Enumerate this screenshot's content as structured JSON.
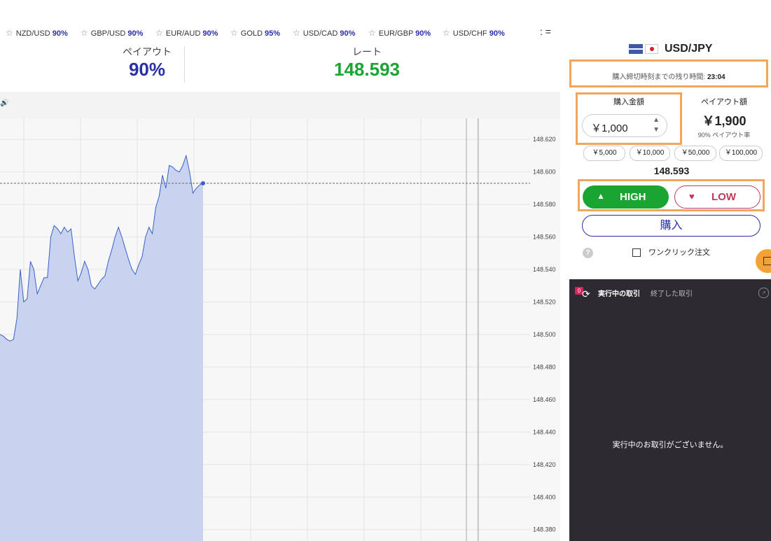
{
  "ticker": {
    "items": [
      {
        "symbol": "NZD/USD",
        "payout": "90%"
      },
      {
        "symbol": "GBP/USD",
        "payout": "90%"
      },
      {
        "symbol": "EUR/AUD",
        "payout": "90%"
      },
      {
        "symbol": "GOLD",
        "payout": "95%"
      },
      {
        "symbol": "USD/CAD",
        "payout": "90%"
      },
      {
        "symbol": "EUR/GBP",
        "payout": "90%"
      },
      {
        "symbol": "USD/CHF",
        "payout": "90%"
      }
    ],
    "menu_glyph": ": ="
  },
  "header": {
    "payout_label": "ペイアウト",
    "payout_value": "90%",
    "rate_label": "レート",
    "rate_value": "148.593"
  },
  "chart": {
    "sound_glyph": "🔊",
    "y_ticks": [
      "148.620",
      "148.600",
      "148.580",
      "148.560",
      "148.540",
      "148.520",
      "148.500",
      "148.480",
      "148.460",
      "148.440",
      "148.420",
      "148.400",
      "148.380"
    ]
  },
  "chart_data": {
    "type": "area",
    "ylim": [
      148.373,
      148.633
    ],
    "y": [
      148.5,
      148.499,
      148.497,
      148.496,
      148.497,
      148.51,
      148.54,
      148.52,
      148.522,
      148.545,
      148.54,
      148.525,
      148.53,
      148.535,
      148.535,
      148.56,
      148.567,
      148.565,
      148.562,
      148.566,
      148.563,
      148.565,
      148.548,
      148.533,
      148.538,
      148.545,
      148.54,
      148.53,
      148.528,
      148.531,
      148.534,
      148.536,
      148.545,
      148.552,
      148.56,
      148.566,
      148.56,
      148.553,
      148.546,
      148.54,
      148.537,
      148.543,
      148.548,
      148.56,
      148.566,
      148.562,
      148.578,
      148.585,
      148.598,
      148.59,
      148.604,
      148.603,
      148.601,
      148.6,
      148.604,
      148.61,
      148.6,
      148.587,
      148.59,
      148.592,
      148.593
    ],
    "reference_rate": 148.593
  },
  "panel": {
    "pair": "USD/JPY",
    "deadline_text": "購入締切時刻までの残り時間:",
    "deadline_time": "23:04",
    "amount_label": "購入金額",
    "amount_value": "￥1,000",
    "payout_label": "ペイアウト額",
    "payout_value": "￥1,900",
    "payout_rate": "90% ペイアウト率",
    "chips": [
      "￥5,000",
      "￥10,000",
      "￥50,000",
      "￥100,000"
    ],
    "current_rate": "148.593",
    "high_label": "HIGH",
    "low_label": "LOW",
    "buy_label": "購入",
    "help_glyph": "?",
    "one_click_label": "ワンクリック注文"
  },
  "trades": {
    "badge_count": "0",
    "tab_active": "実行中の取引",
    "tab_inactive": "終了した取引",
    "empty_message": "実行中のお取引がございません。"
  },
  "colors": {
    "accent_blue": "#2a2fa8",
    "rate_green": "#1aa532",
    "high_green": "#1aa532",
    "low_red": "#c0395a",
    "highlight_orange": "#f2a65a",
    "chart_fill": "#c8d3f0",
    "chart_line": "#3b5fc8"
  }
}
